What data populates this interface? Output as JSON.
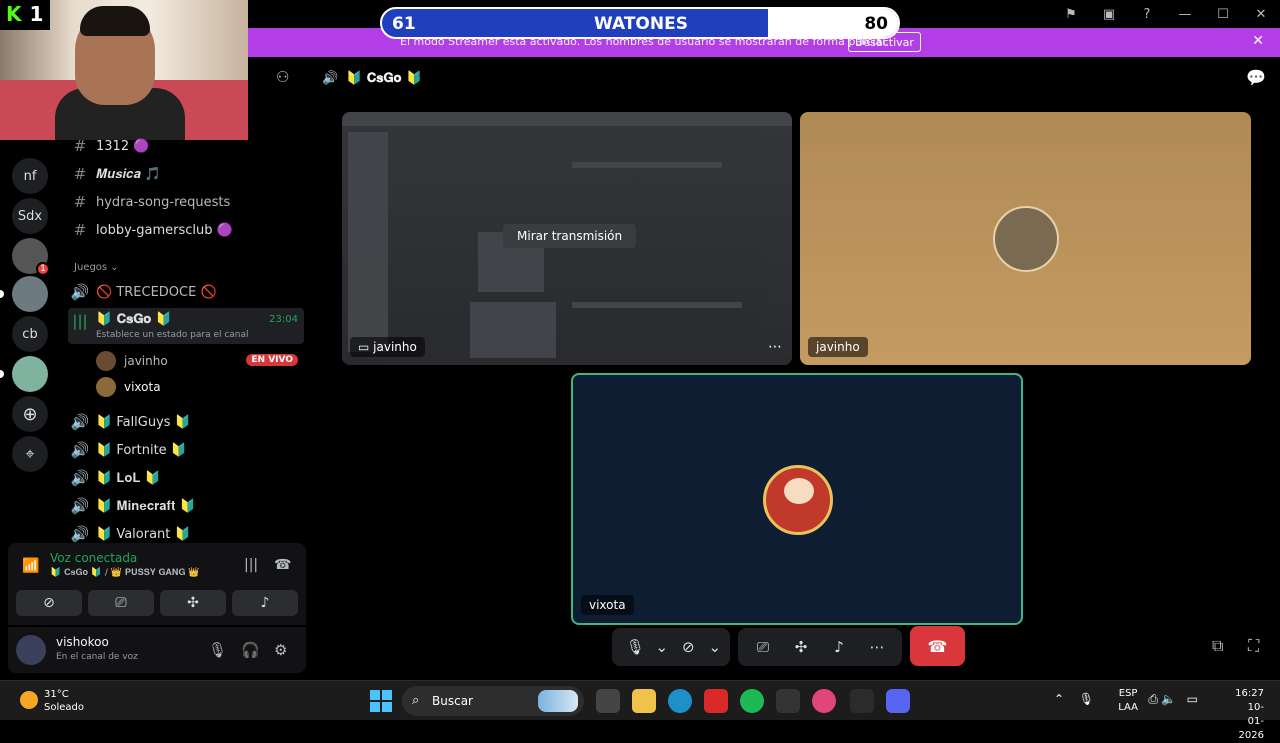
{
  "overlay": {
    "score_left": "61",
    "team_name": "WATONES",
    "score_right": "80",
    "platform_logo": "K",
    "platform_count": "1"
  },
  "banner": {
    "text": "El modo Streamer está activado. Los nombres de usuario se mostrarán de forma parcial.",
    "button": "Desactivar"
  },
  "servers": [
    "nf",
    "Sdx",
    "cb"
  ],
  "server_badge": "1",
  "channels": {
    "text": [
      {
        "name": "1312 🟣"
      },
      {
        "name": "𝑴𝒖𝒔𝒊𝒄𝒂 🎵"
      },
      {
        "name": "hydra-song-requests"
      },
      {
        "name": "lobby-gamersclub 🟣"
      }
    ],
    "category": "Juegos",
    "voice": [
      {
        "name": "🚫 TRECEDOCE 🚫"
      },
      {
        "name": "🔰 𝐂𝐬𝐆𝐨 🔰",
        "time": "23:04",
        "status": "Establece un estado para el canal"
      },
      {
        "name": "🔰 FallGuys 🔰"
      },
      {
        "name": "🔰 Fortnite 🔰"
      },
      {
        "name": "🔰 𝐋𝐨𝐋 🔰"
      },
      {
        "name": "🔰 𝐌𝐢𝐧𝐞𝐜𝐫𝐚𝐟𝐭 🔰"
      },
      {
        "name": "🔰 Valorant 🔰"
      }
    ],
    "members": [
      {
        "name": "javinho",
        "live": "EN VIVO"
      },
      {
        "name": "vixota"
      }
    ]
  },
  "voice_panel": {
    "title": "Voz conectada",
    "subtitle": "🔰 𝐂𝐬𝐆𝐨 🔰 / 👑 𝐏𝐔𝐒𝐒𝐘 𝐆𝐀𝐍𝐆 👑"
  },
  "user_panel": {
    "name": "vishokoo",
    "status": "En el canal de voz"
  },
  "stage": {
    "channel": "🔰 𝐂𝐬𝐆𝐨 🔰",
    "watch_button": "Mirar transmisión",
    "tile1_name": "javinho",
    "tile2_name": "javinho",
    "tile3_name": "vixota"
  },
  "taskbar": {
    "temperature": "31°C",
    "condition": "Soleado",
    "search": "Buscar",
    "lang1": "ESP",
    "lang2": "LAA",
    "time": "16:27",
    "date": "10-01-2026"
  },
  "colors": {
    "banner": "#b33ee8",
    "connected": "#23a55a",
    "leave": "#da373c",
    "live": "#da373c"
  }
}
